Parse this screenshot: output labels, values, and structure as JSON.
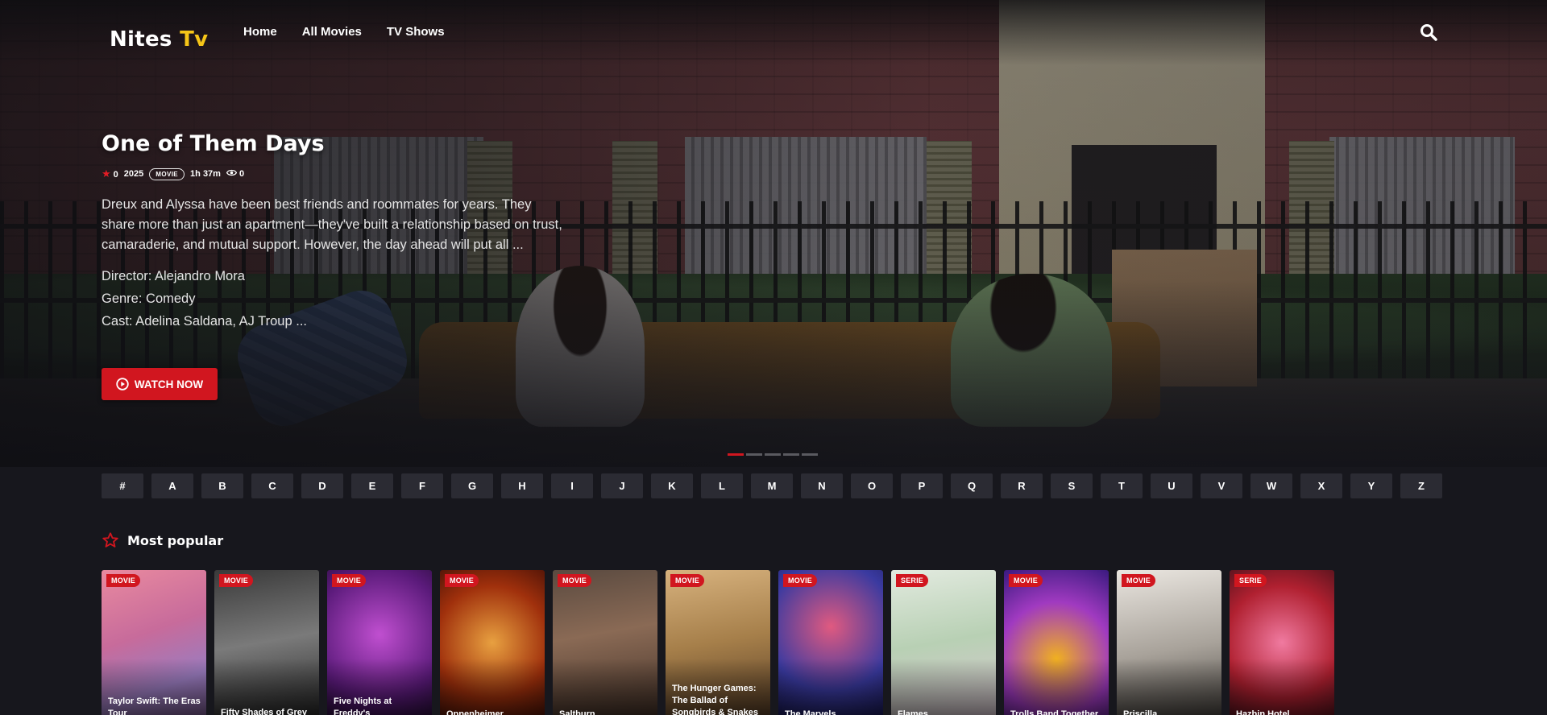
{
  "nav": {
    "logo_main": "Nites",
    "logo_accent": "Tv",
    "links": [
      "Home",
      "All Movies",
      "TV Shows"
    ]
  },
  "hero": {
    "title": "One of Them Days",
    "rating": "0",
    "year": "2025",
    "type_badge": "MOVIE",
    "duration": "1h 37m",
    "views": "0",
    "description": "Dreux and Alyssa have been best friends and roommates for years. They share more than just an apartment—they've built a relationship based on trust, camaraderie, and mutual support. However, the day ahead will put all ...",
    "director": "Director: Alejandro Mora",
    "genre": "Genre: Comedy",
    "cast": "Cast: Adelina Saldana, AJ Troup ...",
    "watch_label": "WATCH NOW"
  },
  "carousel": {
    "count": 5,
    "active": 0
  },
  "alphabet": [
    "#",
    "A",
    "B",
    "C",
    "D",
    "E",
    "F",
    "G",
    "H",
    "I",
    "J",
    "K",
    "L",
    "M",
    "N",
    "O",
    "P",
    "Q",
    "R",
    "S",
    "T",
    "U",
    "V",
    "W",
    "X",
    "Y",
    "Z"
  ],
  "popular": {
    "title": "Most popular",
    "items": [
      {
        "tag": "MOVIE",
        "title": "Taylor Swift: The Eras Tour"
      },
      {
        "tag": "MOVIE",
        "title": "Fifty Shades of Grey"
      },
      {
        "tag": "MOVIE",
        "title": "Five Nights at Freddy's"
      },
      {
        "tag": "MOVIE",
        "title": "Oppenheimer"
      },
      {
        "tag": "MOVIE",
        "title": "Saltburn"
      },
      {
        "tag": "MOVIE",
        "title": "The Hunger Games: The Ballad of Songbirds & Snakes"
      },
      {
        "tag": "MOVIE",
        "title": "The Marvels"
      },
      {
        "tag": "SERIE",
        "title": "Flames"
      },
      {
        "tag": "MOVIE",
        "title": "Trolls Band Together"
      },
      {
        "tag": "MOVIE",
        "title": "Priscilla"
      },
      {
        "tag": "SERIE",
        "title": "Hazbin Hotel"
      }
    ]
  },
  "colors": {
    "accent_red": "#d1161f",
    "logo_yellow": "#f5c518",
    "background": "#17171d"
  },
  "icons": {
    "search": "search-icon",
    "play": "play-circle-icon",
    "star": "star-icon",
    "eye": "eye-icon"
  }
}
